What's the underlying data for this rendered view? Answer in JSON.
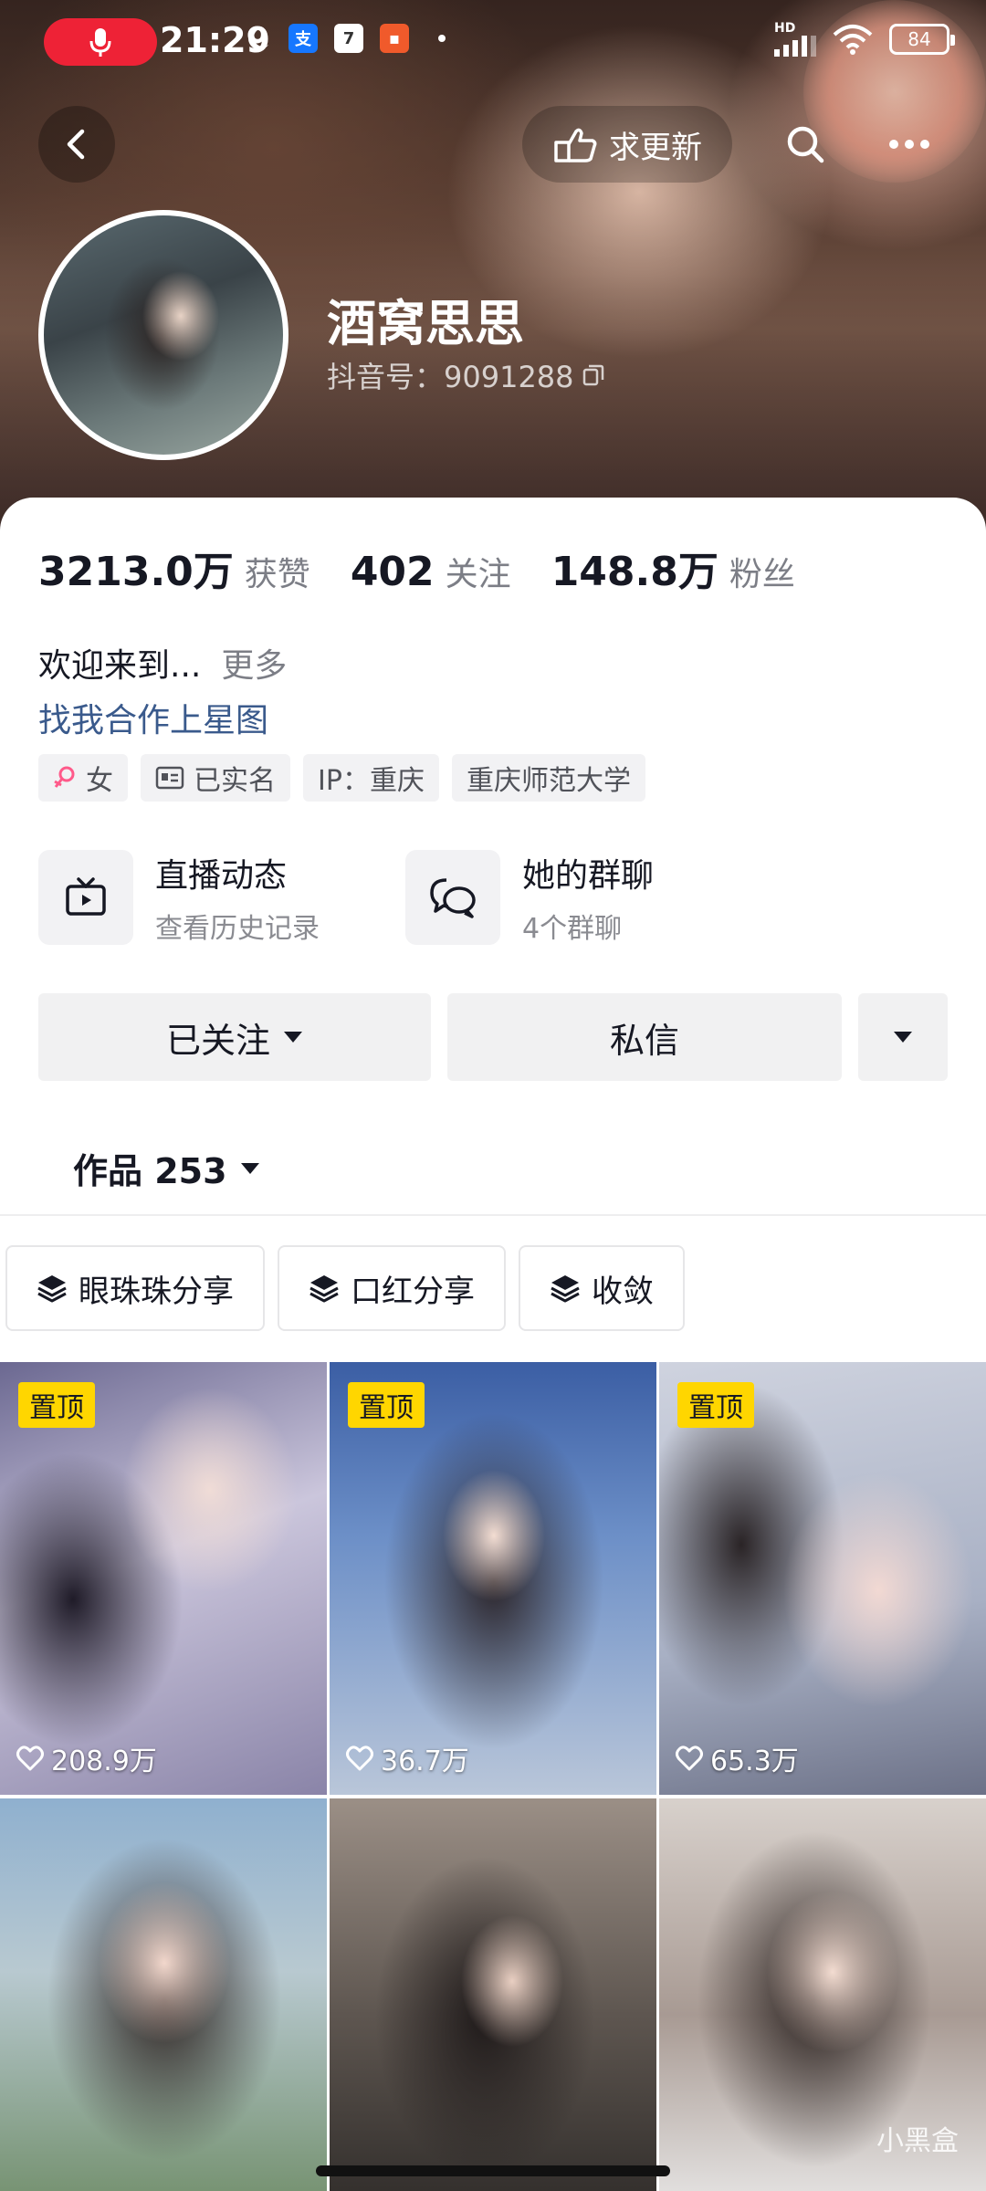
{
  "status_bar": {
    "time": "21:29",
    "calendar_day": "7",
    "hd_label": "HD",
    "battery": "84"
  },
  "header": {
    "update_label": "求更新",
    "name": "酒窝思思",
    "douyin_id": "抖音号：9091288"
  },
  "stats": {
    "likes_value": "3213.0万",
    "likes_label": "获赞",
    "following_value": "402",
    "following_label": "关注",
    "followers_value": "148.8万",
    "followers_label": "粉丝"
  },
  "bio": {
    "text": "欢迎来到...",
    "more": "更多",
    "link": "找我合作上星图"
  },
  "tags": {
    "gender": "女",
    "verified": "已实名",
    "ip": "IP：重庆",
    "school": "重庆师范大学"
  },
  "quick_links": {
    "live_title": "直播动态",
    "live_sub": "查看历史记录",
    "group_title": "她的群聊",
    "group_sub": "4个群聊"
  },
  "actions": {
    "follow": "已关注",
    "message": "私信"
  },
  "works": {
    "label": "作品 253"
  },
  "collections": [
    "眼珠珠分享",
    "口红分享",
    "收敛"
  ],
  "grid": {
    "pin_label": "置顶",
    "likes": [
      "208.9万",
      "36.7万",
      "65.3万"
    ]
  },
  "watermark": "小黑盒",
  "colors": {
    "accent_red": "#ee2236",
    "pin_yellow": "#ffd600",
    "link_blue": "#3a5a8c"
  }
}
